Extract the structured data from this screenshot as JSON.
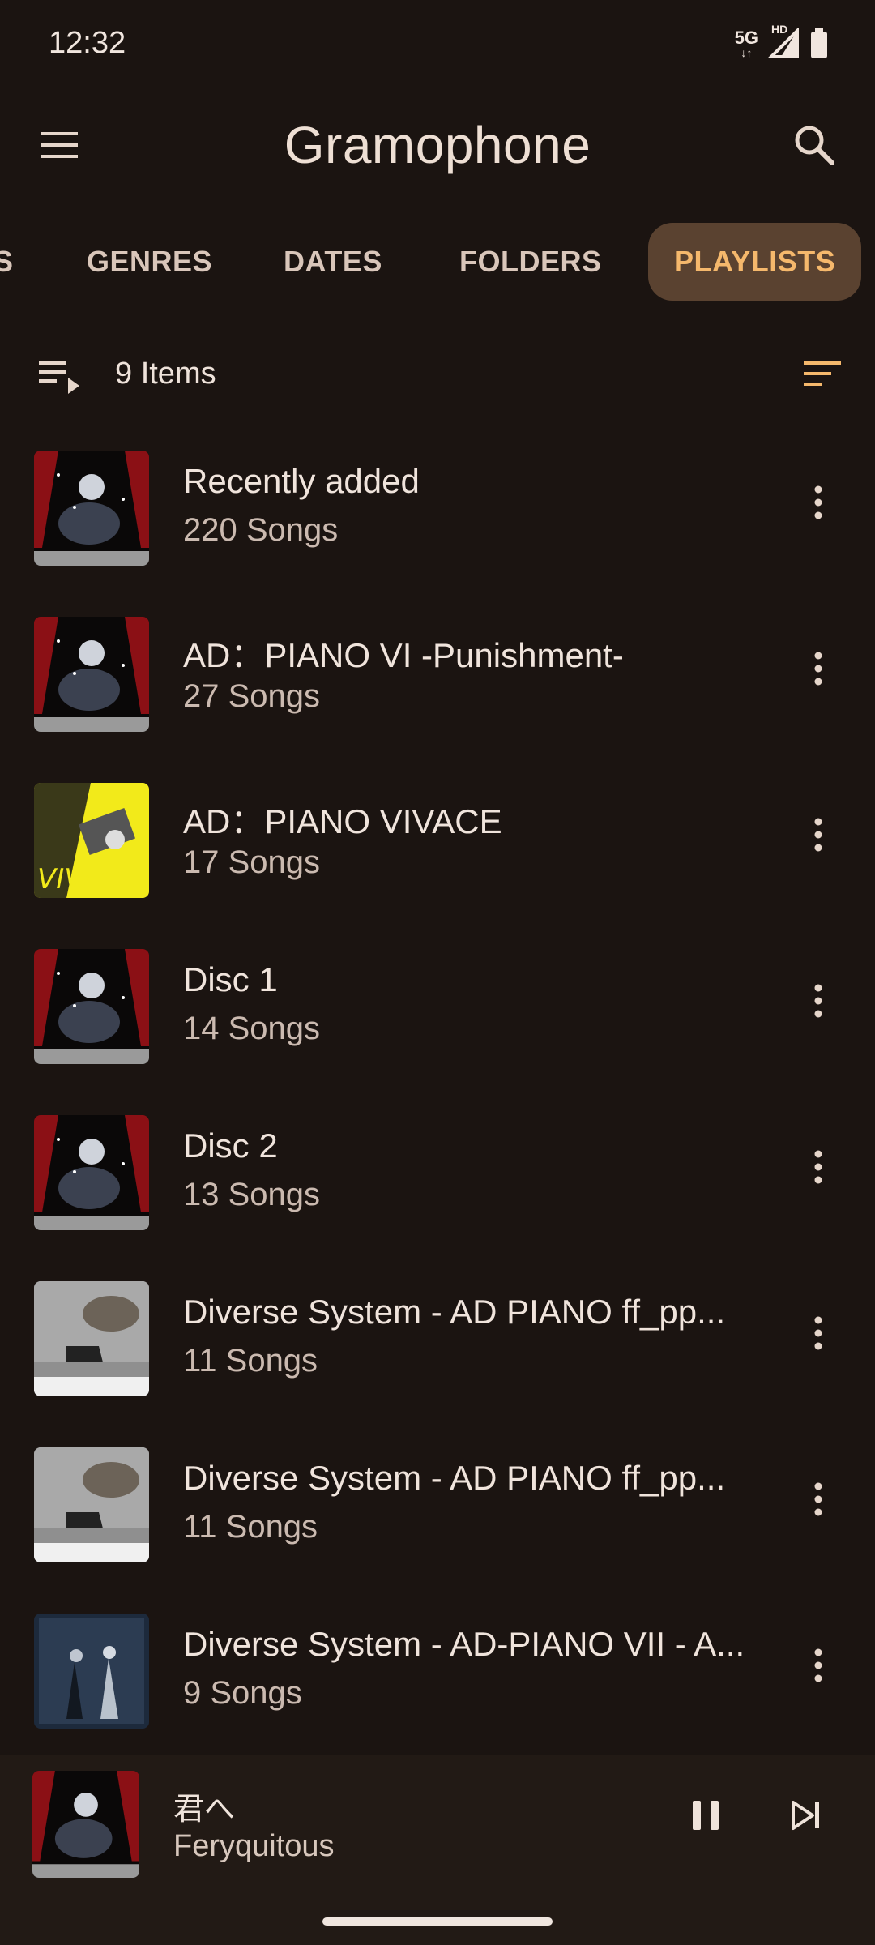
{
  "status": {
    "time": "12:32",
    "network": "5G",
    "hd": "HD"
  },
  "app": {
    "title": "Gramophone"
  },
  "tabs": [
    {
      "label": "S"
    },
    {
      "label": "GENRES"
    },
    {
      "label": "DATES"
    },
    {
      "label": "FOLDERS"
    },
    {
      "label": "PLAYLISTS",
      "active": true
    }
  ],
  "list_header": {
    "count": "9 Items"
  },
  "playlists": [
    {
      "title": "Recently added",
      "subtitle": "220 Songs",
      "art": "dark-stage"
    },
    {
      "title": "AD：PIANO VI -Punishment-",
      "subtitle": "27 Songs",
      "art": "dark-stage"
    },
    {
      "title": "AD：PIANO VIVACE",
      "subtitle": "17 Songs",
      "art": "yellow"
    },
    {
      "title": "Disc 1",
      "subtitle": "14 Songs",
      "art": "dark-stage"
    },
    {
      "title": "Disc 2",
      "subtitle": "13 Songs",
      "art": "dark-stage"
    },
    {
      "title": "Diverse System - AD PIANO ff_pp...",
      "subtitle": "11 Songs",
      "art": "grey-piano"
    },
    {
      "title": "Diverse System - AD PIANO ff_pp...",
      "subtitle": "11 Songs",
      "art": "grey-piano"
    },
    {
      "title": "Diverse System - AD-PIANO VII - A...",
      "subtitle": "9 Songs",
      "art": "blue-night"
    }
  ],
  "now_playing": {
    "title": "君へ",
    "artist": "Feryquitous"
  },
  "colors": {
    "background": "#1b1411",
    "accent": "#f5b86c",
    "active_tab_bg": "#5a4230"
  }
}
